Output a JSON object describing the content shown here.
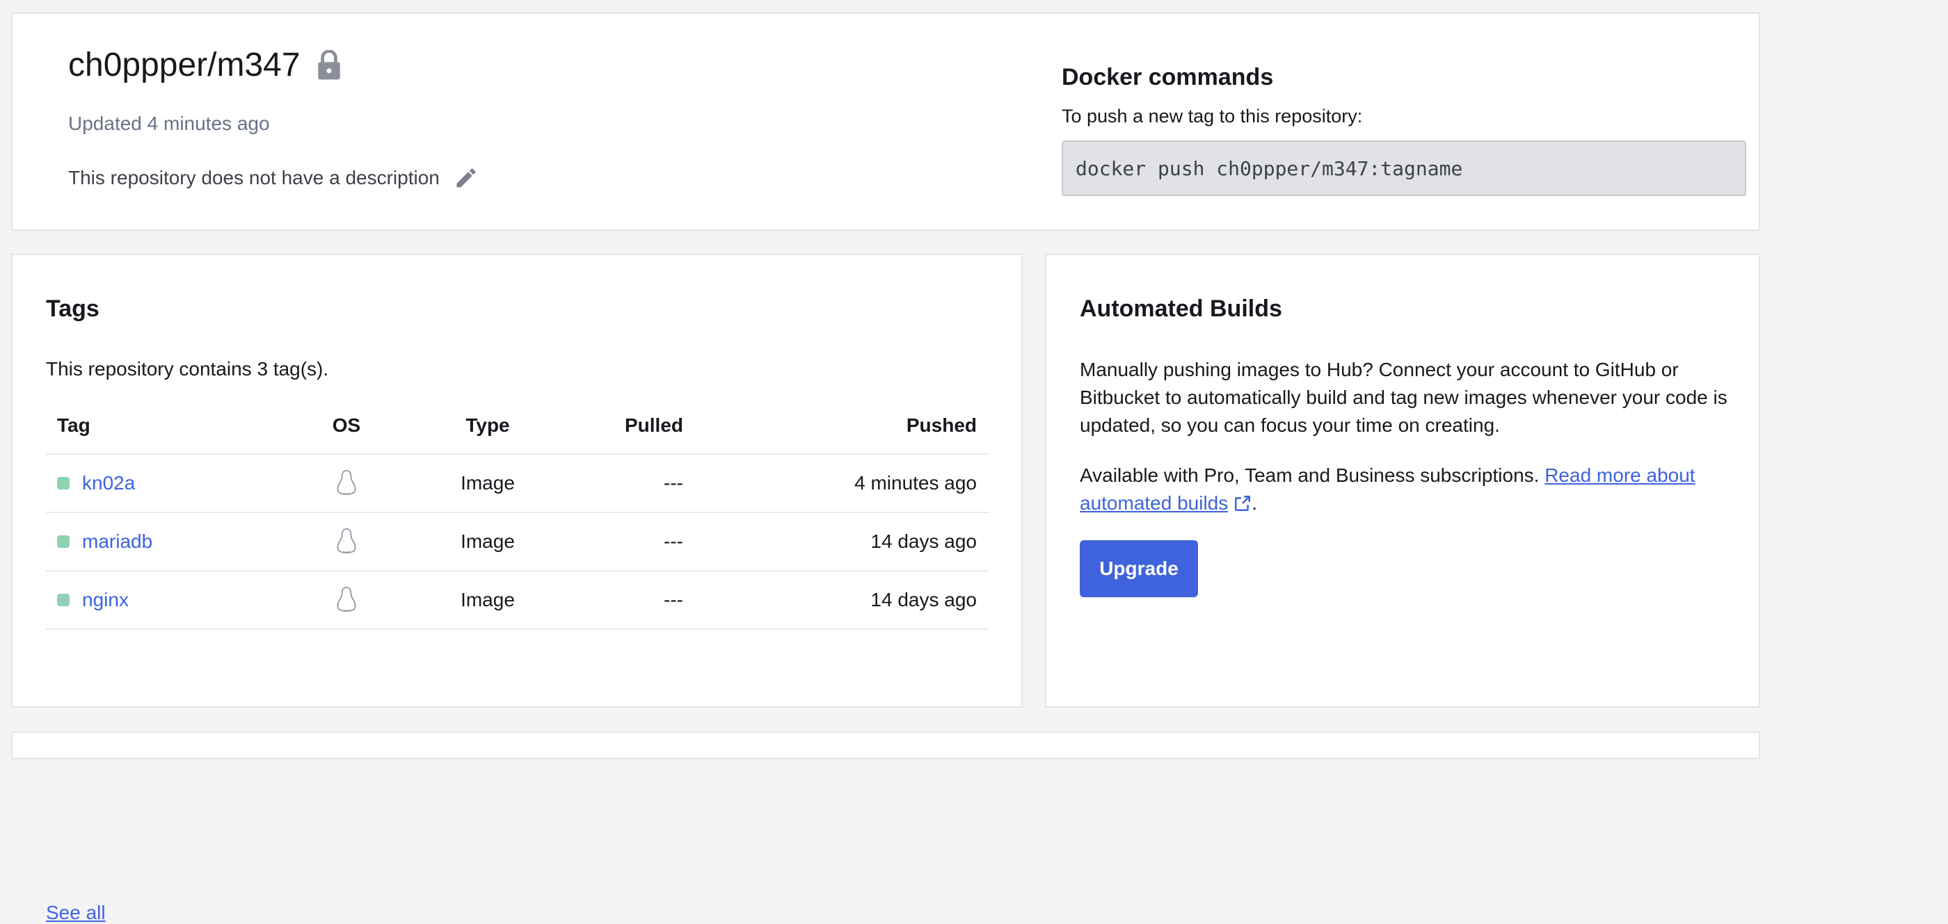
{
  "repo": {
    "name": "ch0ppper/m347",
    "updated": "Updated 4 minutes ago",
    "description": "This repository does not have a description"
  },
  "docker_commands": {
    "title": "Docker commands",
    "subtitle": "To push a new tag to this repository:",
    "command": "docker push ch0ppper/m347:tagname"
  },
  "tags": {
    "title": "Tags",
    "count_text": "This repository contains 3 tag(s).",
    "columns": {
      "tag": "Tag",
      "os": "OS",
      "type": "Type",
      "pulled": "Pulled",
      "pushed": "Pushed"
    },
    "rows": [
      {
        "tag": "kn02a",
        "os_icon": "linux-icon",
        "type": "Image",
        "pulled": "---",
        "pushed": "4 minutes ago"
      },
      {
        "tag": "mariadb",
        "os_icon": "linux-icon",
        "type": "Image",
        "pulled": "---",
        "pushed": "14 days ago"
      },
      {
        "tag": "nginx",
        "os_icon": "linux-icon",
        "type": "Image",
        "pulled": "---",
        "pushed": "14 days ago"
      }
    ],
    "see_all": "See all"
  },
  "automated_builds": {
    "title": "Automated Builds",
    "paragraph": "Manually pushing images to Hub? Connect your account to GitHub or Bitbucket to automatically build and tag new images whenever your code is updated, so you can focus your time on creating.",
    "availability": "Available with Pro, Team and Business subscriptions.",
    "link_text": "Read more about automated builds",
    "link_suffix": ".",
    "upgrade_label": "Upgrade"
  },
  "colors": {
    "accent": "#3e63dd",
    "status_active": "#8fd1b3",
    "muted_text": "#677285",
    "command_bg": "#e1e2e6"
  }
}
